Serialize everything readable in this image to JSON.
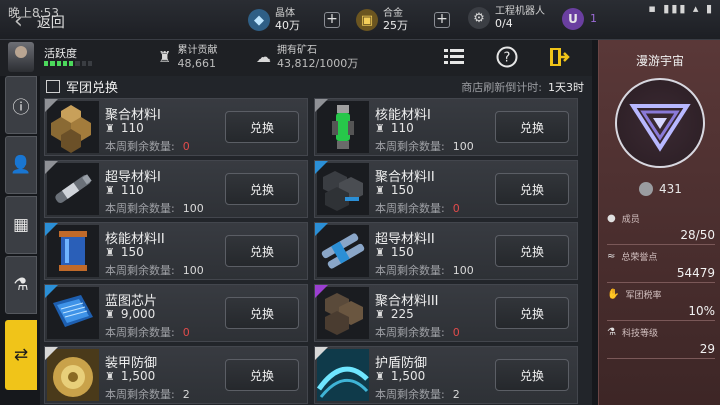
{
  "status_bar": {
    "time": "晚上8:53",
    "system_icons": "▪ ▮▮▮ ▴ ▮"
  },
  "header": {
    "back_label": "返回",
    "resources": [
      {
        "name": "晶体",
        "value": "40万"
      },
      {
        "name": "合金",
        "value": "25万"
      },
      {
        "name": "工程机器人",
        "value": "0/4"
      }
    ],
    "premium_count": "1"
  },
  "info": {
    "activity_label": "活跃度",
    "activity_level": 0.6,
    "contribution_label": "累计贡献",
    "contribution_value": "48,661",
    "ore_label": "拥有矿石",
    "ore_value": "43,812/1000万"
  },
  "shop": {
    "title": "军团兑换",
    "refresh_label": "商店刷新倒计时:",
    "refresh_value": "1天3时",
    "remain_label": "本周剩余数量:",
    "buy_label": "兑换",
    "items": [
      {
        "name": "聚合材料I",
        "price": "110",
        "remaining": "0",
        "rarity_color": "#8f9196"
      },
      {
        "name": "核能材料I",
        "price": "110",
        "remaining": "100",
        "rarity_color": "#8f9196"
      },
      {
        "name": "超导材料I",
        "price": "110",
        "remaining": "100",
        "rarity_color": "#8f9196"
      },
      {
        "name": "聚合材料II",
        "price": "150",
        "remaining": "0",
        "rarity_color": "#2b8fd6"
      },
      {
        "name": "核能材料II",
        "price": "150",
        "remaining": "100",
        "rarity_color": "#2b8fd6"
      },
      {
        "name": "超导材料II",
        "price": "150",
        "remaining": "100",
        "rarity_color": "#2b8fd6"
      },
      {
        "name": "蓝图芯片",
        "price": "9,000",
        "remaining": "0",
        "rarity_color": "#2b8fd6"
      },
      {
        "name": "聚合材料III",
        "price": "225",
        "remaining": "0",
        "rarity_color": "#9b3fd1"
      },
      {
        "name": "装甲防御",
        "price": "1,500",
        "remaining": "2",
        "rarity_color": "#d8d8d8"
      },
      {
        "name": "护盾防御",
        "price": "1,500",
        "remaining": "2",
        "rarity_color": "#d8d8d8"
      }
    ]
  },
  "sidebar": {
    "title": "漫游宇宙",
    "coin_value": "431",
    "stats": [
      {
        "label": "成员",
        "value": "28/50"
      },
      {
        "label": "总荣誉点",
        "value": "54479"
      },
      {
        "label": "军团税率",
        "value": "10%"
      },
      {
        "label": "科技等级",
        "value": "29"
      }
    ]
  },
  "colors": {
    "accent": "#f0c419",
    "zero_count": "#e04b4b",
    "sidebar_bg": "#5a3838"
  }
}
